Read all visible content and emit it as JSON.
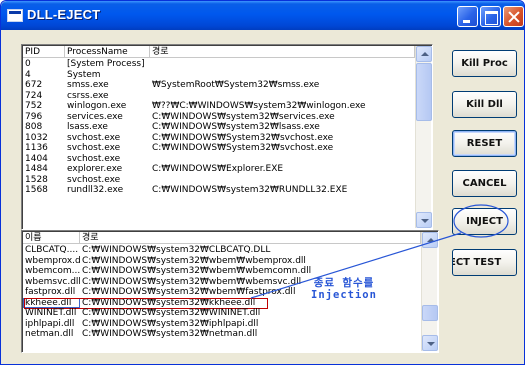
{
  "window": {
    "title": "DLL-EJECT"
  },
  "process_list": {
    "columns": [
      "PID",
      "ProcessName",
      "경로"
    ],
    "rows": [
      {
        "pid": "0",
        "name": "[System Process]",
        "path": ""
      },
      {
        "pid": "4",
        "name": "System",
        "path": ""
      },
      {
        "pid": "672",
        "name": "smss.exe",
        "path": "₩SystemRoot₩System32₩smss.exe"
      },
      {
        "pid": "724",
        "name": "csrss.exe",
        "path": ""
      },
      {
        "pid": "752",
        "name": "winlogon.exe",
        "path": "₩??₩C:₩WINDOWS₩system32₩winlogon.exe"
      },
      {
        "pid": "796",
        "name": "services.exe",
        "path": "C:₩WINDOWS₩system32₩services.exe"
      },
      {
        "pid": "808",
        "name": "lsass.exe",
        "path": "C:₩WINDOWS₩system32₩lsass.exe"
      },
      {
        "pid": "1032",
        "name": "svchost.exe",
        "path": "C:₩WINDOWS₩System32₩svchost.exe"
      },
      {
        "pid": "1136",
        "name": "svchost.exe",
        "path": "C:₩WINDOWS₩System32₩svchost.exe"
      },
      {
        "pid": "1404",
        "name": "svchost.exe",
        "path": ""
      },
      {
        "pid": "1484",
        "name": "explorer.exe",
        "path": "C:₩WINDOWS₩Explorer.EXE"
      },
      {
        "pid": "1528",
        "name": "svchost.exe",
        "path": ""
      },
      {
        "pid": "1568",
        "name": "rundll32.exe",
        "path": "C:₩WINDOWS₩system32₩RUNDLL32.EXE"
      }
    ]
  },
  "module_list": {
    "columns": [
      "이름",
      "경로"
    ],
    "rows": [
      {
        "name": "CLBCATQ....",
        "path": "C:₩WINDOWS₩system32₩CLBCATQ.DLL"
      },
      {
        "name": "wbemprox.dll",
        "path": "C:₩WINDOWS₩system32₩wbem₩wbemprox.dll"
      },
      {
        "name": "wbemcom...",
        "path": "C:₩WINDOWS₩system32₩wbem₩wbemcomn.dll"
      },
      {
        "name": "wbemsvc.dll",
        "path": "C:₩WINDOWS₩system32₩wbem₩wbemsvc.dll"
      },
      {
        "name": "fastprox.dll",
        "path": "C:₩WINDOWS₩system32₩wbem₩fastprox.dll"
      },
      {
        "name": "kkheee.dll",
        "path": "C:₩WINDOWS₩system32₩kkheee.dll"
      },
      {
        "name": "WININET.dll",
        "path": "C:₩WINDOWS₩system32₩WININET.dll"
      },
      {
        "name": "iphlpapi.dll",
        "path": "C:₩WINDOWS₩system32₩iphlpapi.dll"
      },
      {
        "name": "netman.dll",
        "path": "C:₩WINDOWS₩system32₩netman.dll"
      }
    ],
    "highlighted_index": 5
  },
  "buttons": {
    "kill_proc": "Kill Proc",
    "kill_dll": "Kill Dll",
    "reset": "RESET",
    "cancel": "CANCEL",
    "inject": "INJECT",
    "eject_test": "ECT TEST"
  },
  "annotation": {
    "line1": "종료 함수를",
    "line2": "Injection",
    "color": "#2856d6"
  },
  "colors": {
    "titlebar": "#0058ee",
    "window_bg": "#ece9d8",
    "highlight_outline": "#c00000"
  }
}
